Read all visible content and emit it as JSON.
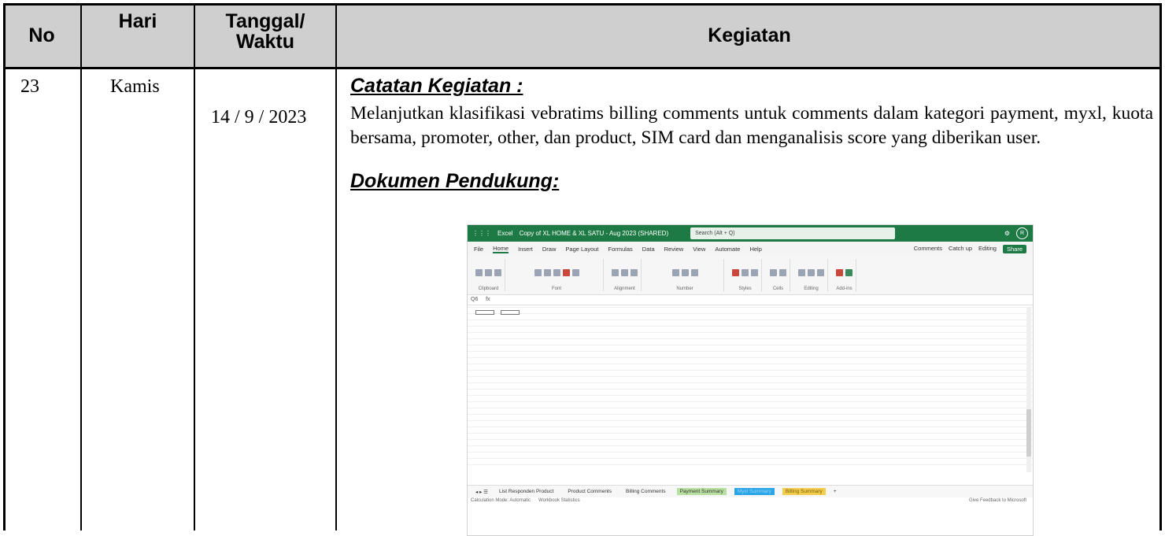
{
  "header": {
    "no": "No",
    "hari": "Hari",
    "tanggal_line1": "Tanggal/",
    "tanggal_line2": "Waktu",
    "kegiatan": "Kegiatan"
  },
  "row": {
    "no": "23",
    "hari": "Kamis",
    "tanggal": "14 / 9 / 2023",
    "notes_title": "Catatan Kegiatan :",
    "notes_text": "Melanjutkan klasifikasi vebratims billing comments untuk comments dalam kategori payment, myxl, kuota bersama, promoter, other, dan product, SIM card dan menganalisis score yang diberikan user.",
    "doc_title": "Dokumen Pendukung:"
  },
  "excel": {
    "app": "Excel",
    "file": "Copy of XL HOME & XL SATU - Aug 2023 (SHARED)",
    "search": "Search (Alt + Q)",
    "avatar": "R",
    "menu": [
      "File",
      "Home",
      "Insert",
      "Draw",
      "Page Layout",
      "Formulas",
      "Data",
      "Review",
      "View",
      "Automate",
      "Help"
    ],
    "menu_right": [
      "Comments",
      "Catch up",
      "Editing",
      "Share"
    ],
    "ribbon_groups": [
      "Clipboard",
      "Font",
      "Alignment",
      "Number",
      "Styles",
      "Cells",
      "Editing",
      "Add-ins"
    ],
    "cell_ref": "Q6",
    "tabs": [
      "List Responden Product",
      "Product Comments",
      "Billing Comments",
      "Payment Summary",
      "Myxl Summary",
      "Billing Summary"
    ],
    "status_left": "Calculation Mode: Automatic",
    "status_mid": "Workbook Statistics",
    "status_right": "Give Feedback to Microsoft"
  }
}
